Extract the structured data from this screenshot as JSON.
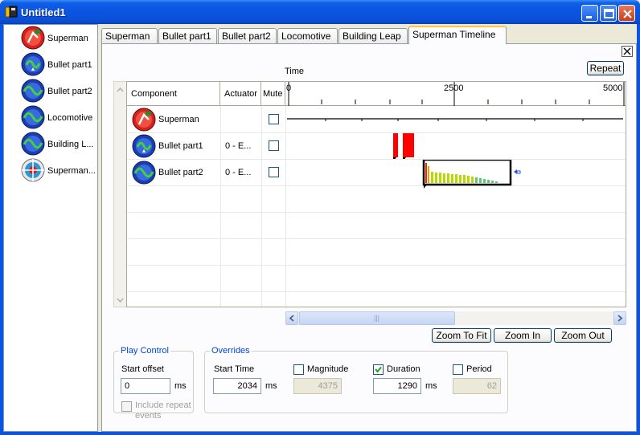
{
  "window": {
    "title": "Untitled1"
  },
  "components": [
    {
      "label": "Superman",
      "icon": "superman-icon"
    },
    {
      "label": "Bullet part1",
      "icon": "bullet-wave-icon"
    },
    {
      "label": "Bullet part2",
      "icon": "wave-icon"
    },
    {
      "label": "Locomotive",
      "icon": "wave-icon"
    },
    {
      "label": "Building L...",
      "icon": "wave-icon"
    },
    {
      "label": "Superman...",
      "icon": "timeline-target-icon"
    }
  ],
  "tabs": [
    "Superman",
    "Bullet part1",
    "Bullet part2",
    "Locomotive",
    "Building Leap",
    "Superman Timeline"
  ],
  "timeline": {
    "time_label": "Time",
    "repeat_label": "Repeat",
    "ruler_ticks": [
      "0",
      "2500",
      "5000"
    ],
    "columns": {
      "component": "Component",
      "actuator": "Actuator",
      "mute": "Mute"
    },
    "rows": [
      {
        "name": "Superman",
        "actuator": "",
        "muted": false
      },
      {
        "name": "Bullet part1",
        "actuator": "0 - E...",
        "muted": false
      },
      {
        "name": "Bullet part2",
        "actuator": "0 - E...",
        "muted": false
      }
    ],
    "zoom_to_fit": "Zoom To Fit",
    "zoom_in": "Zoom In",
    "zoom_out": "Zoom Out",
    "hscroll_grip": "|||"
  },
  "play_control": {
    "legend": "Play Control",
    "start_offset_label": "Start offset",
    "start_offset_value": "0",
    "unit": "ms",
    "include_repeat_label_1": "Include repeat",
    "include_repeat_label_2": "events"
  },
  "overrides": {
    "legend": "Overrides",
    "start_time_label": "Start Time",
    "start_time_value": "2034",
    "start_time_unit": "ms",
    "magnitude_label": "Magnitude",
    "magnitude_checked": false,
    "magnitude_value": "4375",
    "duration_label": "Duration",
    "duration_checked": true,
    "duration_value": "1290",
    "duration_unit": "ms",
    "period_label": "Period",
    "period_checked": false,
    "period_value": "62"
  }
}
